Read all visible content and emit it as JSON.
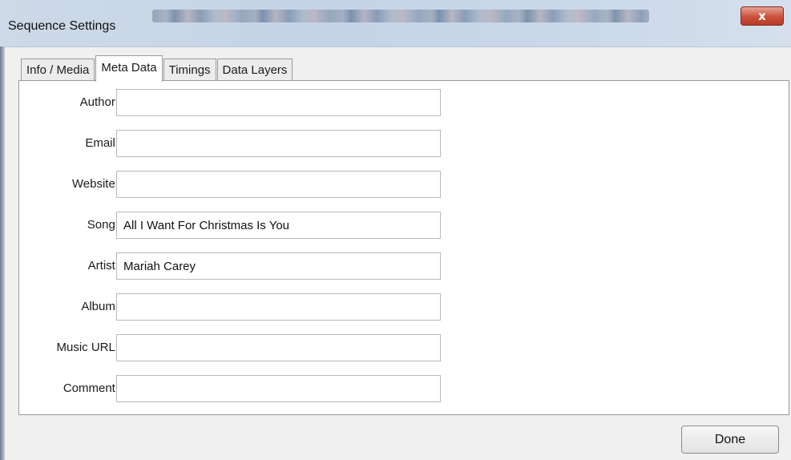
{
  "window": {
    "title": "Sequence Settings",
    "close_label": "x"
  },
  "tabs": [
    {
      "label": "Info / Media",
      "active": false
    },
    {
      "label": "Meta Data",
      "active": true
    },
    {
      "label": "Timings",
      "active": false
    },
    {
      "label": "Data Layers",
      "active": false
    }
  ],
  "fields": {
    "author": {
      "label": "Author:",
      "value": ""
    },
    "email": {
      "label": "Email:",
      "value": ""
    },
    "website": {
      "label": "Website:",
      "value": ""
    },
    "song": {
      "label": "Song:",
      "value": "All I Want For Christmas Is You"
    },
    "artist": {
      "label": "Artist:",
      "value": "Mariah Carey"
    },
    "album": {
      "label": "Album:",
      "value": ""
    },
    "music_url": {
      "label": "Music URL:",
      "value": ""
    },
    "comment": {
      "label": "Comment:",
      "value": ""
    }
  },
  "footer": {
    "done_label": "Done"
  }
}
